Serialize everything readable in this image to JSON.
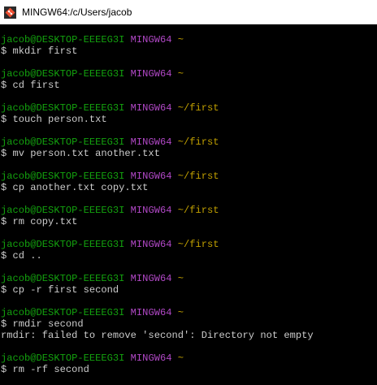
{
  "window": {
    "title": "MINGW64:/c/Users/jacob"
  },
  "colors": {
    "user": "#13a10e",
    "mingw": "#b148c6",
    "path": "#c1a000",
    "text": "#cccccc",
    "background": "#000000"
  },
  "terminal": {
    "prompt_user": "jacob@DESKTOP-EEEEG3I",
    "prompt_env": "MINGW64",
    "blocks": [
      {
        "path": "~",
        "command": "$ mkdir first",
        "output": []
      },
      {
        "path": "~",
        "command": "$ cd first",
        "output": []
      },
      {
        "path": "~/first",
        "command": "$ touch person.txt",
        "output": []
      },
      {
        "path": "~/first",
        "command": "$ mv person.txt another.txt",
        "output": []
      },
      {
        "path": "~/first",
        "command": "$ cp another.txt copy.txt",
        "output": []
      },
      {
        "path": "~/first",
        "command": "$ rm copy.txt",
        "output": []
      },
      {
        "path": "~/first",
        "command": "$ cd ..",
        "output": []
      },
      {
        "path": "~",
        "command": "$ cp -r first second",
        "output": []
      },
      {
        "path": "~",
        "command": "$ rmdir second",
        "output": [
          "rmdir: failed to remove 'second': Directory not empty"
        ]
      },
      {
        "path": "~",
        "command": "$ rm -rf second",
        "output": []
      }
    ]
  }
}
